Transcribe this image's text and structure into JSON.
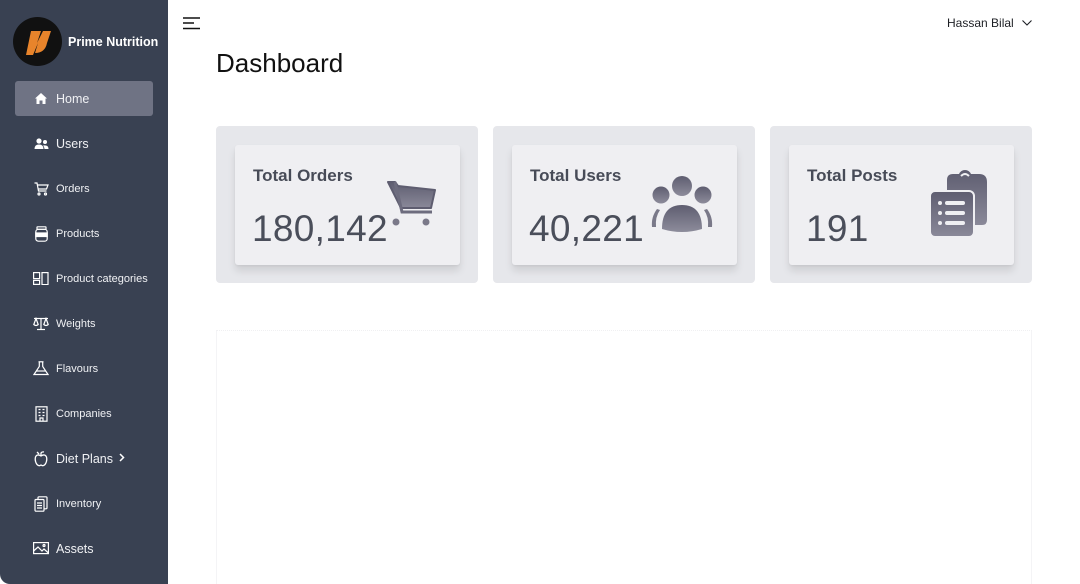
{
  "brand": {
    "name": "Prime Nutrition",
    "logo_colors": {
      "background": "#111111",
      "mark": "#e8842b"
    }
  },
  "sidebar": {
    "items": [
      {
        "label": "Home",
        "icon": "home-icon",
        "active": true
      },
      {
        "label": "Users",
        "icon": "users-icon"
      },
      {
        "label": "Orders",
        "icon": "cart-icon"
      },
      {
        "label": "Products",
        "icon": "jar-icon"
      },
      {
        "label": "Product categories",
        "icon": "categories-icon"
      },
      {
        "label": "Weights",
        "icon": "scale-icon"
      },
      {
        "label": "Flavours",
        "icon": "flask-icon"
      },
      {
        "label": "Companies",
        "icon": "building-icon"
      },
      {
        "label": "Diet Plans",
        "icon": "apple-icon",
        "has_submenu": true
      },
      {
        "label": "Inventory",
        "icon": "clipboard-icon"
      },
      {
        "label": "Assets",
        "icon": "image-icon"
      }
    ]
  },
  "header": {
    "user_name": "Hassan Bilal"
  },
  "page": {
    "title": "Dashboard"
  },
  "stats": [
    {
      "title": "Total Orders",
      "value": "180,142",
      "icon": "cart-icon"
    },
    {
      "title": "Total Users",
      "value": "40,221",
      "icon": "users-group-icon"
    },
    {
      "title": "Total Posts",
      "value": "191",
      "icon": "clipboard-list-icon"
    }
  ],
  "colors": {
    "sidebar_bg": "#394152",
    "active_item": "#6f7384",
    "icon_gray": "#6d6c7e"
  }
}
